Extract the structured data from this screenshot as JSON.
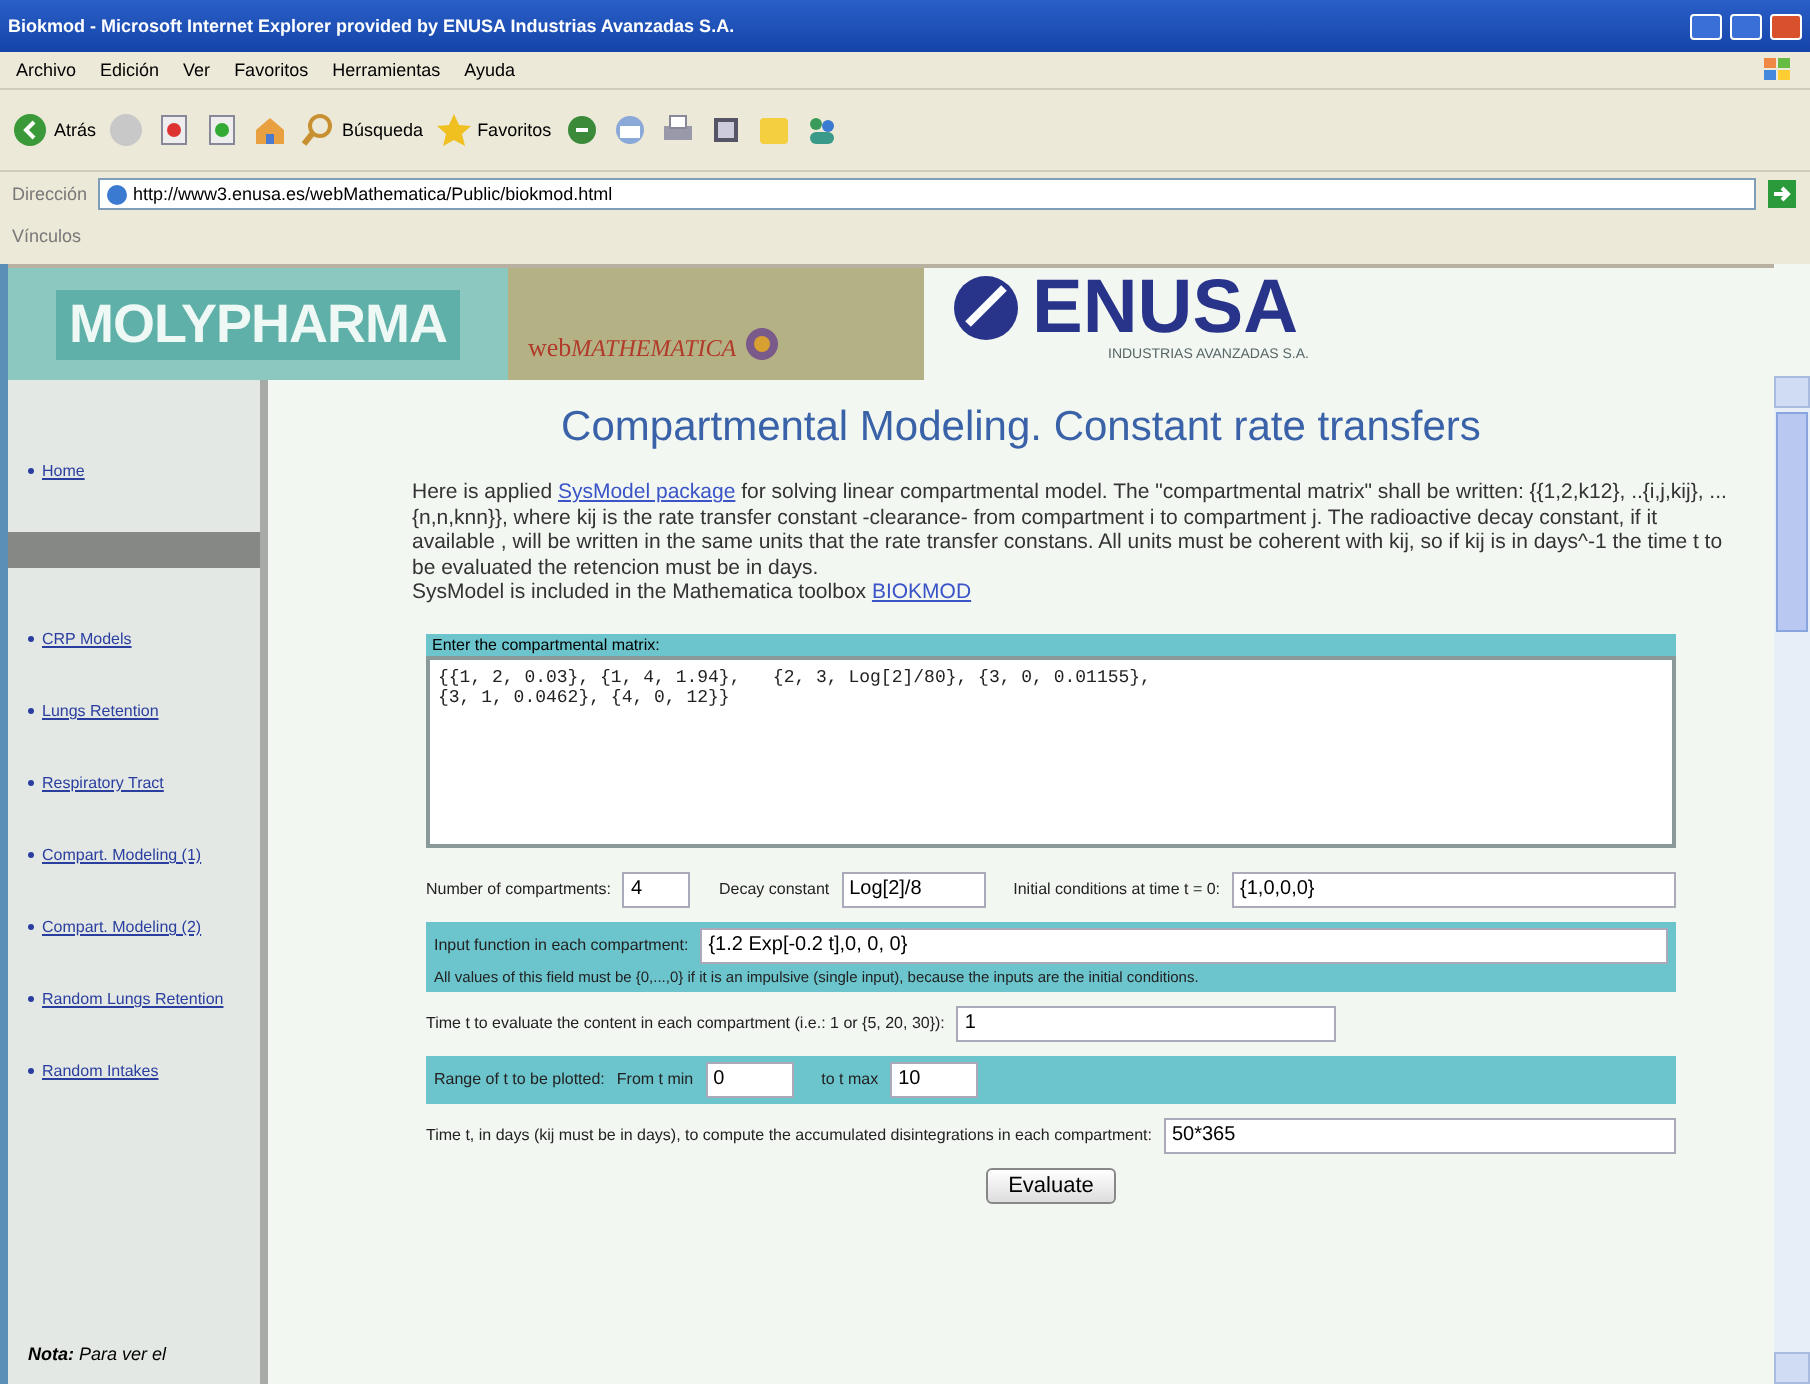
{
  "window": {
    "title": "Biokmod - Microsoft Internet Explorer provided by ENUSA Industrias Avanzadas S.A."
  },
  "menu": [
    "Archivo",
    "Edición",
    "Ver",
    "Favoritos",
    "Herramientas",
    "Ayuda"
  ],
  "toolbar": {
    "back": "Atrás",
    "search": "Búsqueda",
    "favorites": "Favoritos"
  },
  "address": {
    "label": "Dirección",
    "url": "http://www3.enusa.es/webMathematica/Public/biokmod.html"
  },
  "links_bar": "Vínculos",
  "header": {
    "brand": "MOLYPHARMA",
    "webmath_prefix": "web",
    "webmath": "MATHEMATICA",
    "enusa": "ENUSA",
    "enusa_sub": "INDUSTRIAS AVANZADAS S.A."
  },
  "sidebar": {
    "items": [
      {
        "label": "Home"
      },
      {
        "label": "CRP Models"
      },
      {
        "label": "Lungs Retention"
      },
      {
        "label": "Respiratory Tract"
      },
      {
        "label": "Compart. Modeling (1)"
      },
      {
        "label": "Compart. Modeling (2)"
      },
      {
        "label": "Random Lungs Retention"
      },
      {
        "label": "Random Intakes"
      }
    ],
    "note_label": "Nota:",
    "note_text": "Para ver el"
  },
  "page": {
    "title": "Compartmental Modeling. Constant rate transfers",
    "intro_before": "Here is applied ",
    "intro_link": "SysModel package",
    "intro_after": " for solving linear compartmental model. The \"compartmental matrix\" shall be written: {{1,2,k12}, ..{i,j,kij}, ...{n,n,knn}}, where kij is the rate transfer constant -clearance- from compartment i to compartment j. The radioactive decay constant, if it available , will be written in the same units that the rate transfer constans. All units must be coherent with kij, so if kij is in days^-1 the time t to be evaluated the retencion must be in days.",
    "toolbox_text": "SysModel is included in the Mathematica toolbox ",
    "toolbox_link": "BIOKMOD"
  },
  "form": {
    "matrix_label": "Enter the compartmental matrix:",
    "matrix_value": "{{1, 2, 0.03}, {1, 4, 1.94},   {2, 3, Log[2]/80}, {3, 0, 0.01155},\n{3, 1, 0.0462}, {4, 0, 12}}",
    "compartments_label": "Number of compartments:",
    "compartments_value": "4",
    "decay_label": "Decay constant",
    "decay_value": "Log[2]/8",
    "initial_label": "Initial conditions at time t = 0:",
    "initial_value": "{1,0,0,0}",
    "input_label": "Input function in each compartment:",
    "input_value": "{1.2 Exp[-0.2 t],0, 0, 0}",
    "input_note": "All values of this field must be {0,...,0} if it is an impulsive (single input), because the inputs are the initial conditions.",
    "time_label": "Time t to evaluate the content in each compartment (i.e.: 1 or {5, 20, 30}):",
    "time_value": "1",
    "range_label": "Range of t to be plotted:",
    "from_label": "From t min",
    "from_value": "0",
    "to_label": "to t max",
    "to_value": "10",
    "accum_label": "Time t, in days (kij must be in days), to compute the accumulated disintegrations in each compartment:",
    "accum_value": "50*365",
    "button": "Evaluate"
  }
}
